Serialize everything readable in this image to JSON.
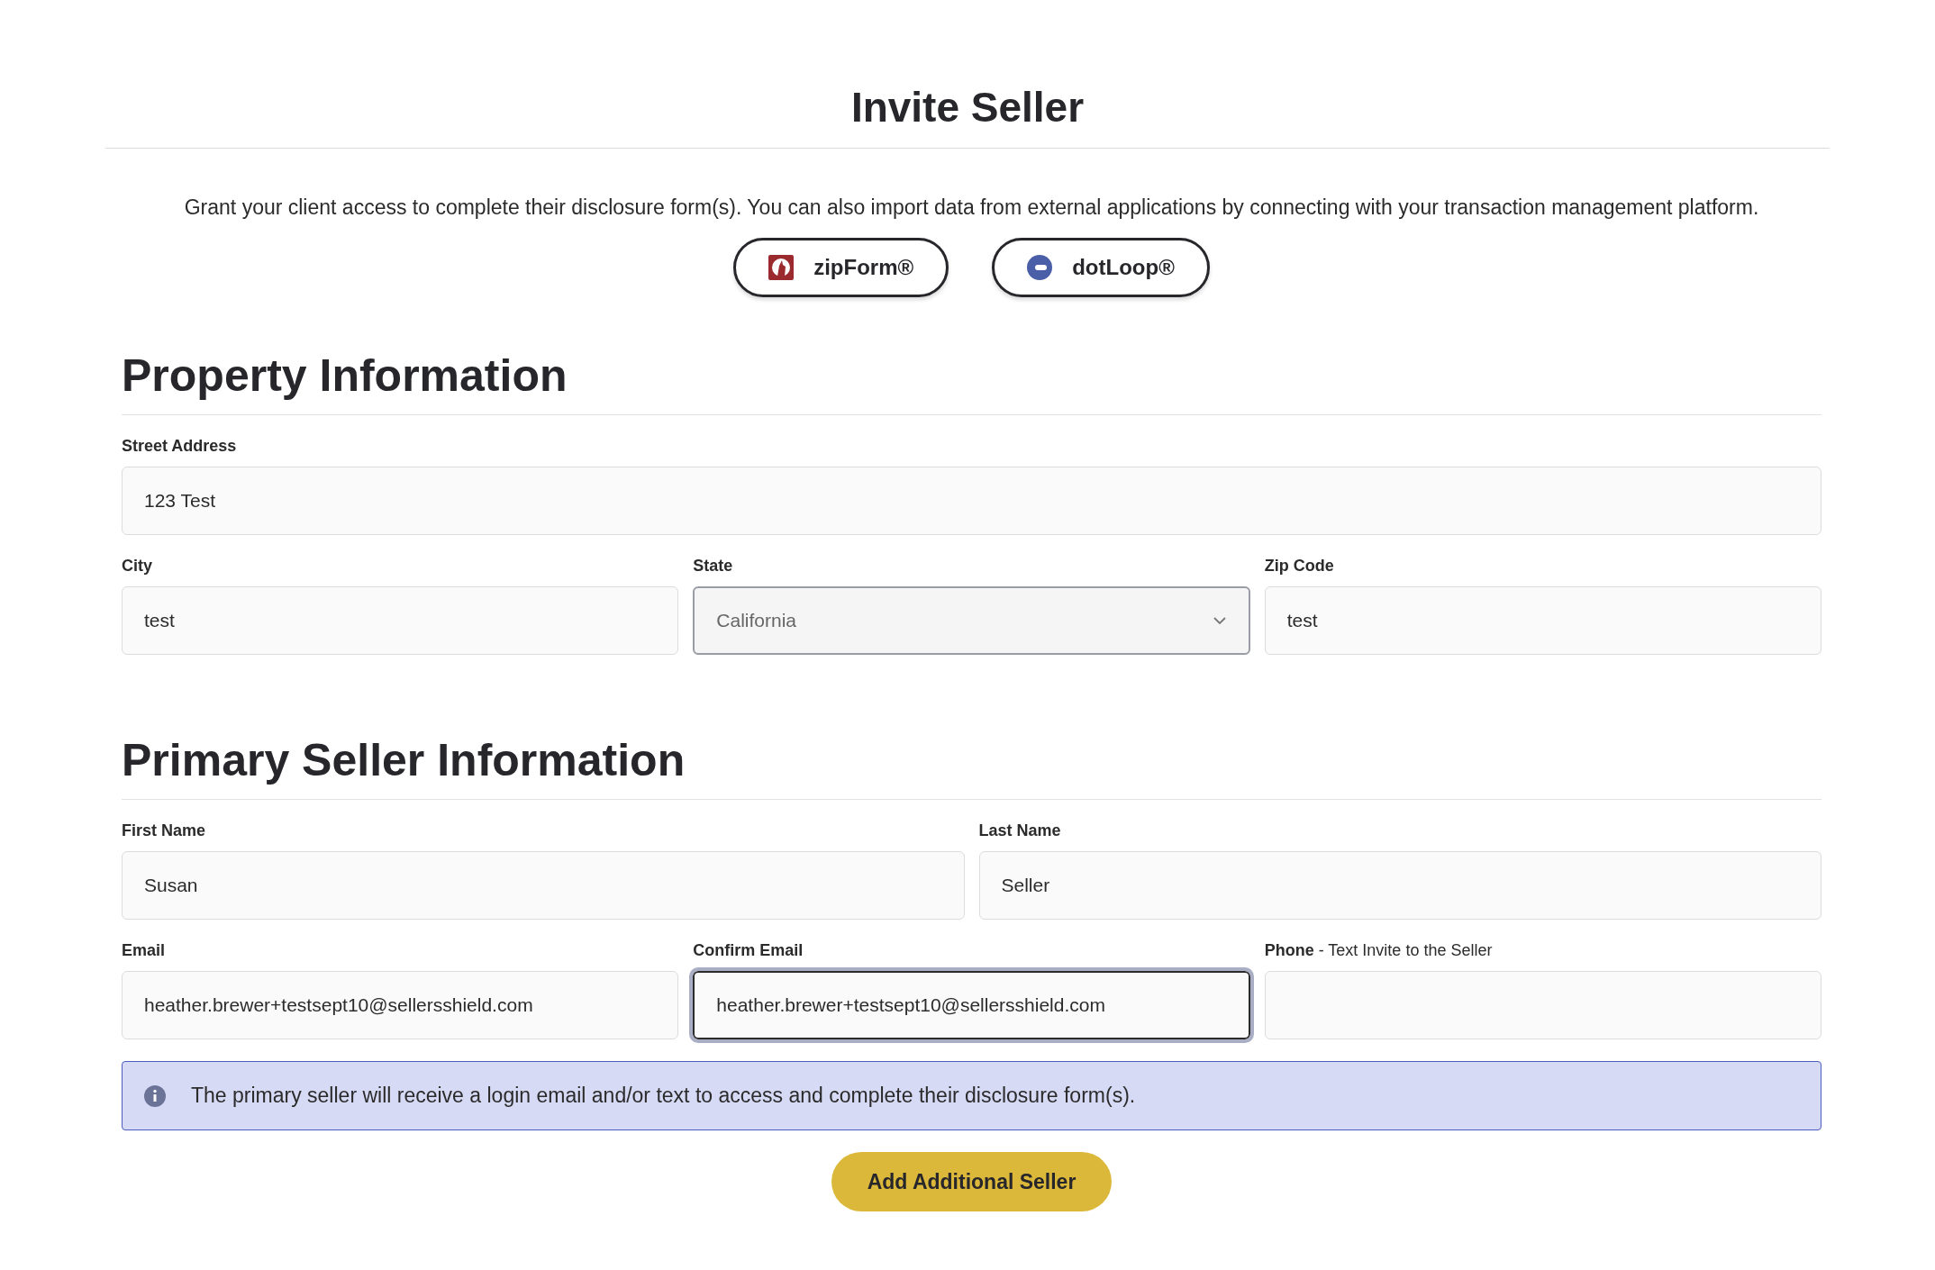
{
  "title": "Invite Seller",
  "description": "Grant your client access to complete their disclosure form(s). You can also import data from external applications by connecting with your transaction management platform.",
  "integrations": [
    {
      "label": "zipForm®",
      "kind": "zipform"
    },
    {
      "label": "dotLoop®",
      "kind": "dotloop"
    }
  ],
  "sections": [
    {
      "heading": "Property Information",
      "rows": [
        [
          {
            "label": "Street Address",
            "value": "123 Test",
            "kind": "text",
            "focused": false
          }
        ],
        [
          {
            "label": "City",
            "value": "test",
            "kind": "text",
            "focused": false
          },
          {
            "label": "State",
            "value": "California",
            "kind": "select",
            "focused": false
          },
          {
            "label": "Zip Code",
            "value": "test",
            "kind": "text",
            "focused": false
          }
        ]
      ]
    },
    {
      "heading": "Primary Seller Information",
      "rows": [
        [
          {
            "label": "First Name",
            "value": "Susan",
            "kind": "text",
            "focused": false
          },
          {
            "label": "Last Name",
            "value": "Seller",
            "kind": "text",
            "focused": false
          }
        ],
        [
          {
            "label": "Email",
            "value": "heather.brewer+testsept10@sellersshield.com",
            "kind": "text",
            "focused": false
          },
          {
            "label": "Confirm Email",
            "value": "heather.brewer+testsept10@sellersshield.com",
            "kind": "text",
            "focused": true
          },
          {
            "label": "**Phone** - Text Invite to the Seller",
            "kind": "text",
            "focused": false
          }
        ]
      ]
    }
  ],
  "notice": "The primary seller will receive a login email and/or text to access and complete their disclosure form(s).",
  "add_button": "Add Additional Seller"
}
